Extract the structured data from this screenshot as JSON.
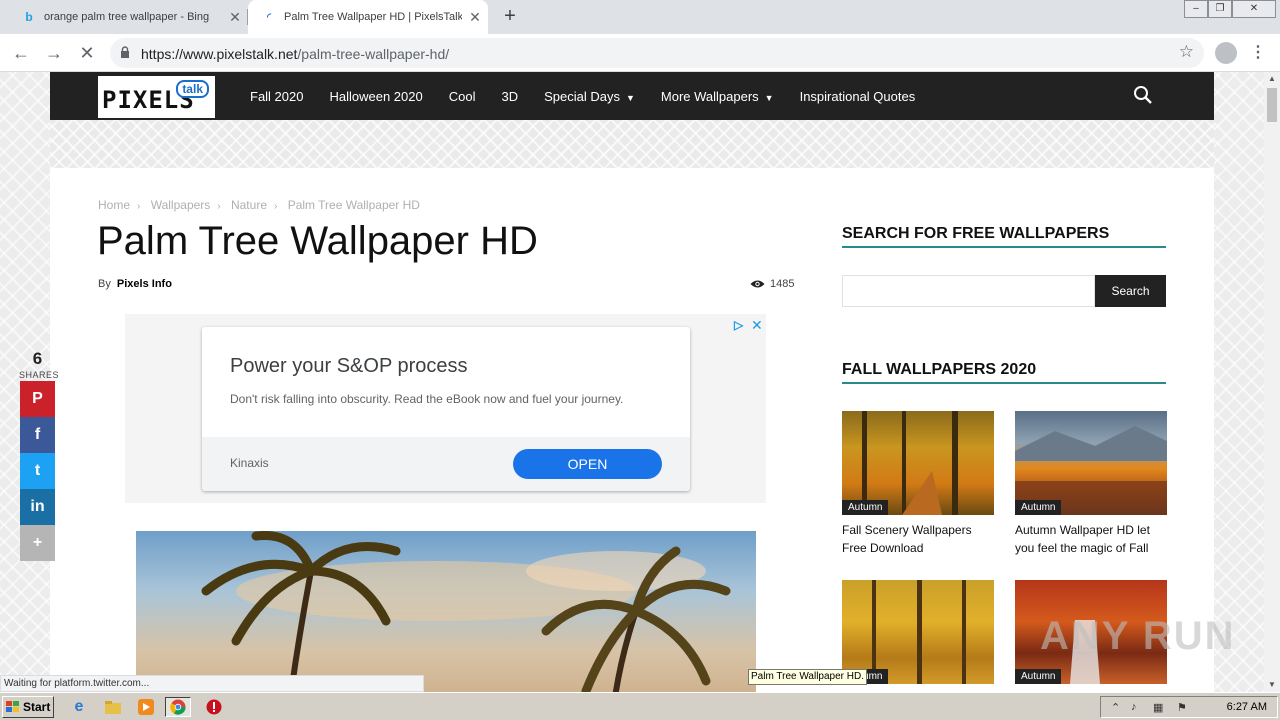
{
  "browser": {
    "tabs": [
      {
        "title": "orange palm tree wallpaper - Bing",
        "favicon": "bing-icon"
      },
      {
        "title": "Palm Tree Wallpaper HD | PixelsTalk",
        "favicon": "loading-icon"
      }
    ],
    "url_host": "https://www.pixelstalk.net",
    "url_path": "/palm-tree-wallpaper-hd/",
    "status": "Waiting for platform.twitter.com...",
    "tooltip": "Palm Tree Wallpaper HD."
  },
  "site": {
    "logo_word": "PIXELS",
    "logo_bubble": "talk",
    "nav": [
      {
        "label": "Fall 2020"
      },
      {
        "label": "Halloween 2020"
      },
      {
        "label": "Cool"
      },
      {
        "label": "3D"
      },
      {
        "label": "Special Days",
        "dropdown": true
      },
      {
        "label": "More Wallpapers",
        "dropdown": true
      },
      {
        "label": "Inspirational Quotes"
      }
    ]
  },
  "article": {
    "breadcrumbs": [
      "Home",
      "Wallpapers",
      "Nature",
      "Palm Tree Wallpaper HD"
    ],
    "title": "Palm Tree Wallpaper HD",
    "by_label": "By",
    "author": "Pixels Info",
    "views": "1485"
  },
  "share": {
    "count": "6",
    "label": "SHARES",
    "buttons": [
      {
        "network": "pinterest",
        "glyph": "P",
        "color": "#ca212a"
      },
      {
        "network": "facebook",
        "glyph": "f",
        "color": "#3b5998"
      },
      {
        "network": "twitter",
        "glyph": "t",
        "color": "#1da1f2"
      },
      {
        "network": "linkedin",
        "glyph": "in",
        "color": "#1a6fa5"
      },
      {
        "network": "more",
        "glyph": "+",
        "color": "#b5b5b5"
      }
    ]
  },
  "ad": {
    "headline": "Power your S&OP process",
    "body": "Don't risk falling into obscurity. Read the eBook now and fuel your journey.",
    "brand": "Kinaxis",
    "cta": "OPEN"
  },
  "sidebar": {
    "search_title": "SEARCH FOR FREE WALLPAPERS",
    "search_button": "Search",
    "fall_title": "FALL WALLPAPERS 2020",
    "cards": [
      {
        "tag": "Autumn",
        "caption": "Fall Scenery Wallpapers Free Download"
      },
      {
        "tag": "Autumn",
        "caption": "Autumn Wallpaper HD let you feel the magic of Fall"
      },
      {
        "tag": "Autumn",
        "caption": ""
      },
      {
        "tag": "Autumn",
        "caption": ""
      }
    ]
  },
  "watermark": "ANY RUN",
  "taskbar": {
    "start": "Start",
    "clock": "6:27 AM"
  },
  "colors": {
    "accent_teal": "#2a8a8a",
    "header_dark": "#222222",
    "ad_button": "#1a73e8"
  }
}
